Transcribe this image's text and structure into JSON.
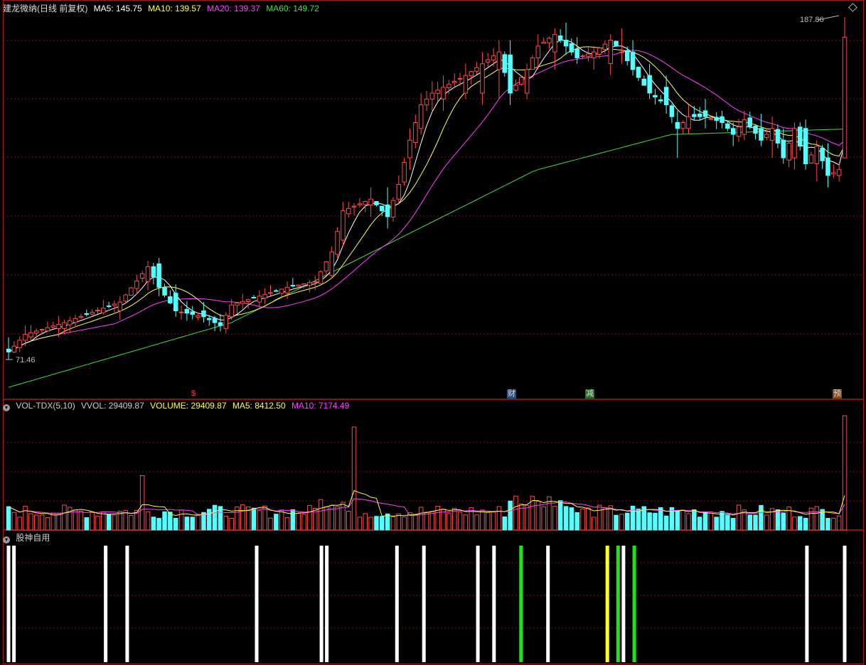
{
  "main": {
    "title": "建龙微纳(日线 前复权)",
    "ma5_label": "MA5: 145.75",
    "ma10_label": "MA10: 139.57",
    "ma20_label": "MA20: 139.37",
    "ma60_label": "MA60: 149.72",
    "high_label": "187.86",
    "low_label": "71.46"
  },
  "markers": {
    "m1": "$",
    "m2": "财",
    "m3": "减",
    "m4": "预"
  },
  "volume": {
    "title": "VOL-TDX(5,10)",
    "vvol": "VVOL: 29409.87",
    "volume": "VOLUME: 29409.87",
    "ma5": "MA5: 8412.50",
    "ma10": "MA10: 7174.49"
  },
  "indicator": {
    "title": "股神自用"
  },
  "colors": {
    "up": "#ff4a4a",
    "down": "#54ffff",
    "ma5": "#ffffff",
    "ma10": "#ffff40",
    "ma20": "#ff40ff",
    "ma60": "#40e040",
    "grid": "#7a1010"
  },
  "chart_data": {
    "type": "candlestick",
    "n": 151,
    "price_range": [
      71.46,
      187.86
    ],
    "key_prices": [
      [
        0,
        75,
        79,
        71.46,
        74
      ],
      [
        3,
        78,
        83,
        76,
        80
      ],
      [
        10,
        82,
        85,
        80,
        84
      ],
      [
        20,
        88,
        93,
        85,
        91
      ],
      [
        25,
        98,
        105,
        95,
        103
      ],
      [
        27,
        104,
        106,
        93,
        96
      ],
      [
        30,
        94,
        97,
        86,
        88
      ],
      [
        35,
        88,
        91,
        84,
        86
      ],
      [
        38,
        84,
        87,
        81,
        83
      ],
      [
        40,
        86,
        92,
        85,
        90
      ],
      [
        45,
        91,
        95,
        89,
        93
      ],
      [
        50,
        94,
        98,
        92,
        96
      ],
      [
        55,
        98,
        100,
        95,
        98
      ],
      [
        58,
        100,
        110,
        99,
        108
      ],
      [
        60,
        112,
        125,
        110,
        122
      ],
      [
        65,
        124,
        130,
        120,
        126
      ],
      [
        68,
        124,
        130,
        116,
        120
      ],
      [
        70,
        126,
        134,
        124,
        131
      ],
      [
        72,
        140,
        150,
        136,
        146
      ],
      [
        74,
        150,
        162,
        148,
        158
      ],
      [
        76,
        160,
        166,
        156,
        162
      ],
      [
        78,
        160,
        168,
        156,
        164
      ],
      [
        82,
        162,
        172,
        160,
        168
      ],
      [
        85,
        162,
        176,
        158,
        172
      ],
      [
        88,
        170,
        180,
        160,
        176
      ],
      [
        90,
        175,
        180,
        158,
        162
      ],
      [
        93,
        162,
        172,
        160,
        170
      ],
      [
        95,
        174,
        182,
        170,
        178
      ],
      [
        98,
        176,
        184,
        170,
        182
      ],
      [
        100,
        180,
        186,
        175,
        178
      ],
      [
        102,
        177,
        181,
        172,
        174
      ],
      [
        105,
        174,
        178,
        170,
        176
      ],
      [
        108,
        172,
        182,
        168,
        180
      ],
      [
        110,
        176,
        184,
        172,
        176
      ],
      [
        112,
        176,
        180,
        168,
        170
      ],
      [
        115,
        168,
        172,
        160,
        162
      ],
      [
        118,
        164,
        168,
        155,
        158
      ],
      [
        120,
        152,
        156,
        140,
        150
      ],
      [
        122,
        150,
        158,
        148,
        154
      ],
      [
        125,
        156,
        160,
        150,
        154
      ],
      [
        128,
        154,
        156,
        150,
        152
      ],
      [
        130,
        150,
        152,
        144,
        148
      ],
      [
        132,
        148,
        156,
        146,
        153
      ],
      [
        135,
        150,
        155,
        144,
        146
      ],
      [
        137,
        146,
        154,
        140,
        150
      ],
      [
        139,
        146,
        150,
        138,
        140
      ],
      [
        141,
        140,
        152,
        136,
        150
      ],
      [
        143,
        150,
        153,
        136,
        138
      ],
      [
        145,
        138,
        146,
        132,
        144
      ],
      [
        147,
        140,
        145,
        130,
        134
      ],
      [
        149,
        134,
        138,
        132,
        136
      ],
      [
        150,
        140,
        187.86,
        140,
        181
      ]
    ],
    "ma5_last": 145.75,
    "ma10_last": 139.57,
    "ma20_last": 139.37,
    "ma60_last": 149.72,
    "volume_last": 29409.87,
    "vol_ma5_last": 8412.5,
    "vol_ma10_last": 7174.49,
    "indicator_signals": [
      {
        "i": 0,
        "c": "white"
      },
      {
        "i": 1,
        "c": "white"
      },
      {
        "i": 18,
        "c": "white"
      },
      {
        "i": 22,
        "c": "white"
      },
      {
        "i": 46,
        "c": "white"
      },
      {
        "i": 58,
        "c": "white"
      },
      {
        "i": 59,
        "c": "white"
      },
      {
        "i": 72,
        "c": "white"
      },
      {
        "i": 77,
        "c": "white"
      },
      {
        "i": 87,
        "c": "white"
      },
      {
        "i": 90,
        "c": "white"
      },
      {
        "i": 95,
        "c": "green"
      },
      {
        "i": 100,
        "c": "white"
      },
      {
        "i": 111,
        "c": "yellow"
      },
      {
        "i": 113,
        "c": "green"
      },
      {
        "i": 114,
        "c": "white"
      },
      {
        "i": 116,
        "c": "green"
      },
      {
        "i": 148,
        "c": "white"
      },
      {
        "i": 155,
        "c": "white"
      }
    ]
  }
}
